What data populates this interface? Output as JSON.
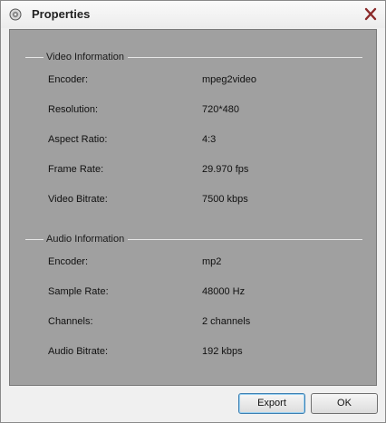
{
  "window": {
    "title": "Properties"
  },
  "video": {
    "section_title": "Video Information",
    "rows": [
      {
        "label": "Encoder:",
        "value": "mpeg2video"
      },
      {
        "label": "Resolution:",
        "value": "720*480"
      },
      {
        "label": "Aspect Ratio:",
        "value": "4:3"
      },
      {
        "label": "Frame Rate:",
        "value": "29.970 fps"
      },
      {
        "label": "Video Bitrate:",
        "value": "7500 kbps"
      }
    ]
  },
  "audio": {
    "section_title": "Audio Information",
    "rows": [
      {
        "label": "Encoder:",
        "value": "mp2"
      },
      {
        "label": "Sample Rate:",
        "value": "48000 Hz"
      },
      {
        "label": "Channels:",
        "value": "2 channels"
      },
      {
        "label": "Audio Bitrate:",
        "value": "192 kbps"
      }
    ]
  },
  "buttons": {
    "export_label": "Export",
    "ok_label": "OK"
  },
  "icons": {
    "app": "disc-icon",
    "close": "close-icon"
  },
  "colors": {
    "panel_bg": "#a0a0a0",
    "close_x": "#8b2a2a",
    "focus_border": "#3c7fb1"
  }
}
